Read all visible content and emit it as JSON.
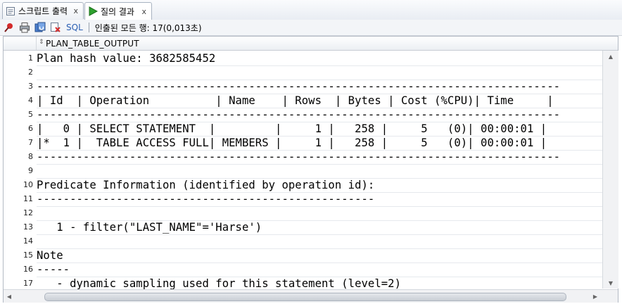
{
  "tabs": [
    {
      "label": "스크립트 출력",
      "icon": "script-output-icon",
      "close": "x"
    },
    {
      "label": "질의 결과",
      "icon": "run-query-icon",
      "close": "x"
    }
  ],
  "toolbar": {
    "sql_label": "SQL",
    "status": "인출된 모든 행: 17(0,013초)",
    "icons": [
      "pin-icon",
      "print-icon",
      "refresh-icon",
      "clear-icon"
    ]
  },
  "grid": {
    "column": "PLAN_TABLE_OUTPUT",
    "rows": [
      {
        "n": "1",
        "text": "Plan hash value: 3682585452"
      },
      {
        "n": "2",
        "text": ""
      },
      {
        "n": "3",
        "text": "-------------------------------------------------------------------------------"
      },
      {
        "n": "4",
        "text": "| Id  | Operation          | Name    | Rows  | Bytes | Cost (%CPU)| Time     |"
      },
      {
        "n": "5",
        "text": "-------------------------------------------------------------------------------"
      },
      {
        "n": "6",
        "text": "|   0 | SELECT STATEMENT  |         |     1 |   258 |     5   (0)| 00:00:01 |"
      },
      {
        "n": "7",
        "text": "|*  1 |  TABLE ACCESS FULL| MEMBERS |     1 |   258 |     5   (0)| 00:00:01 |"
      },
      {
        "n": "8",
        "text": "-------------------------------------------------------------------------------"
      },
      {
        "n": "9",
        "text": ""
      },
      {
        "n": "10",
        "text": "Predicate Information (identified by operation id):"
      },
      {
        "n": "11",
        "text": "---------------------------------------------------"
      },
      {
        "n": "12",
        "text": ""
      },
      {
        "n": "13",
        "text": "   1 - filter(\"LAST_NAME\"='Harse')"
      },
      {
        "n": "14",
        "text": ""
      },
      {
        "n": "15",
        "text": "Note"
      },
      {
        "n": "16",
        "text": "-----"
      },
      {
        "n": "17",
        "text": "   - dynamic sampling used for this statement (level=2)"
      }
    ]
  }
}
